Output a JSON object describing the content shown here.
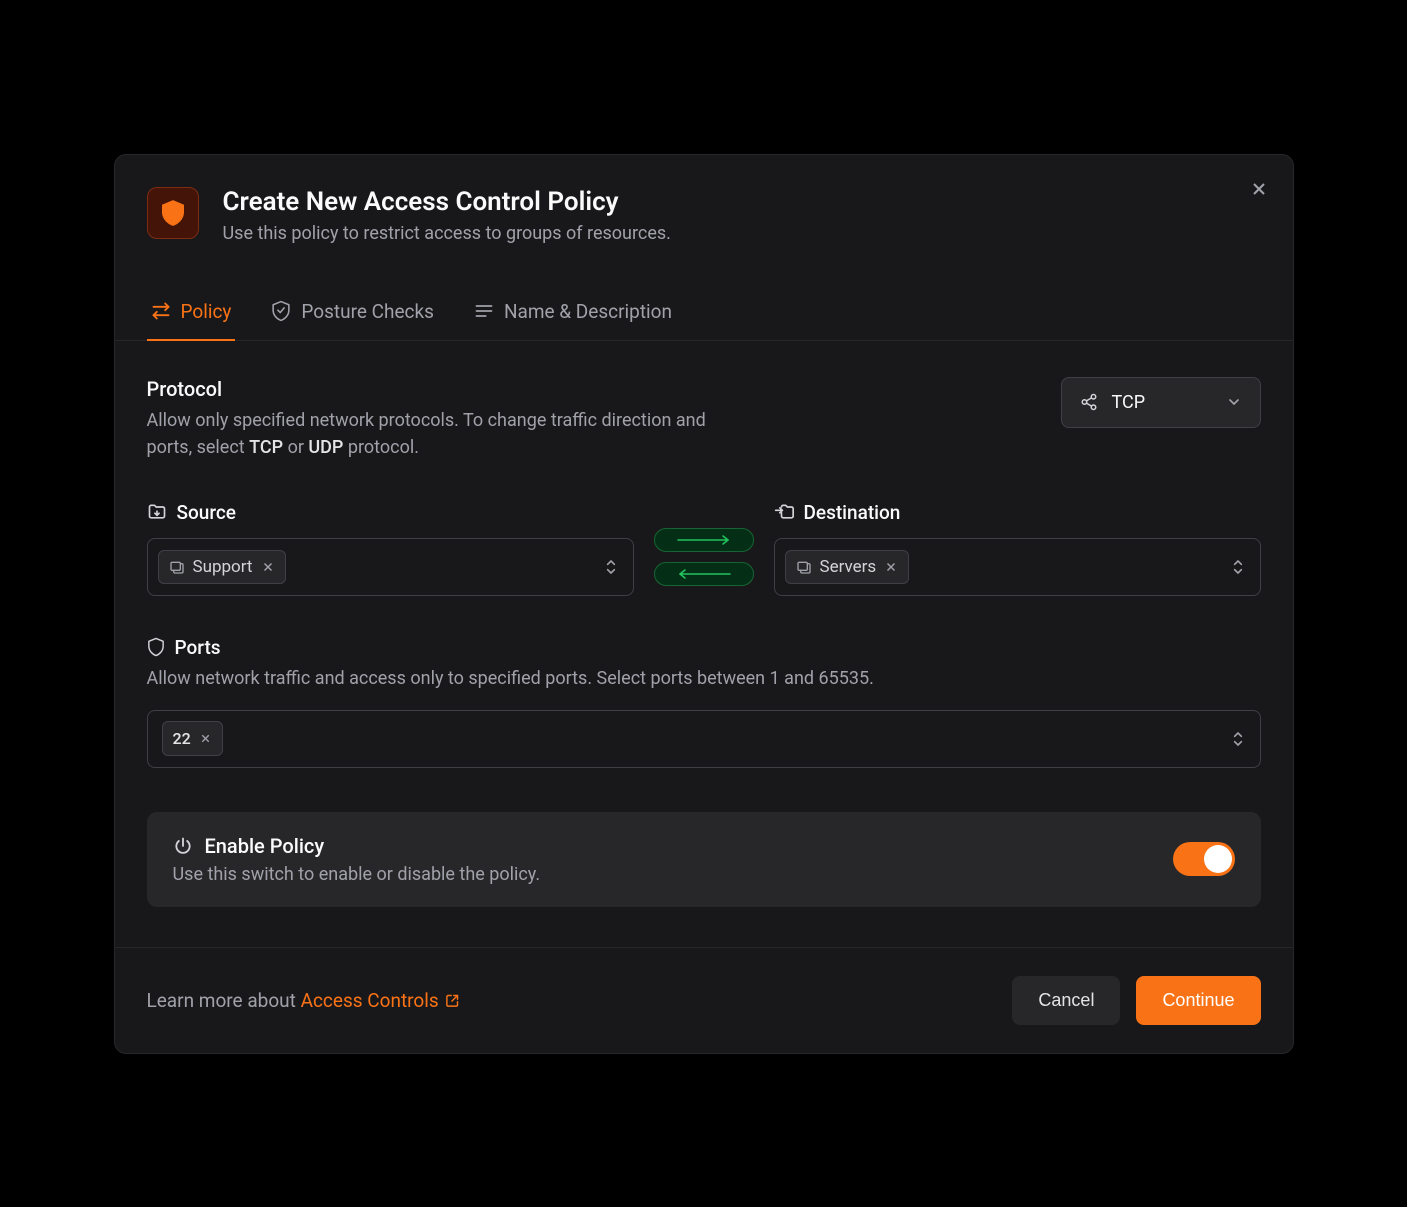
{
  "header": {
    "title": "Create New Access Control Policy",
    "subtitle": "Use this policy to restrict access to groups of resources."
  },
  "tabs": [
    {
      "label": "Policy",
      "active": true
    },
    {
      "label": "Posture Checks",
      "active": false
    },
    {
      "label": "Name & Description",
      "active": false
    }
  ],
  "protocol": {
    "title": "Protocol",
    "desc_pre": "Allow only specified network protocols. To change traffic direction and ports, select ",
    "desc_b1": "TCP",
    "desc_mid": " or ",
    "desc_b2": "UDP",
    "desc_post": " protocol.",
    "selected": "TCP"
  },
  "source": {
    "label": "Source",
    "tags": [
      "Support"
    ]
  },
  "destination": {
    "label": "Destination",
    "tags": [
      "Servers"
    ]
  },
  "ports": {
    "title": "Ports",
    "desc": "Allow network traffic and access only to specified ports. Select ports between 1 and 65535.",
    "values": [
      "22"
    ]
  },
  "enable": {
    "title": "Enable Policy",
    "subtitle": "Use this switch to enable or disable the policy.",
    "on": true
  },
  "footer": {
    "learn_prefix": "Learn more about ",
    "learn_link_label": "Access Controls",
    "cancel": "Cancel",
    "continue": "Continue"
  }
}
